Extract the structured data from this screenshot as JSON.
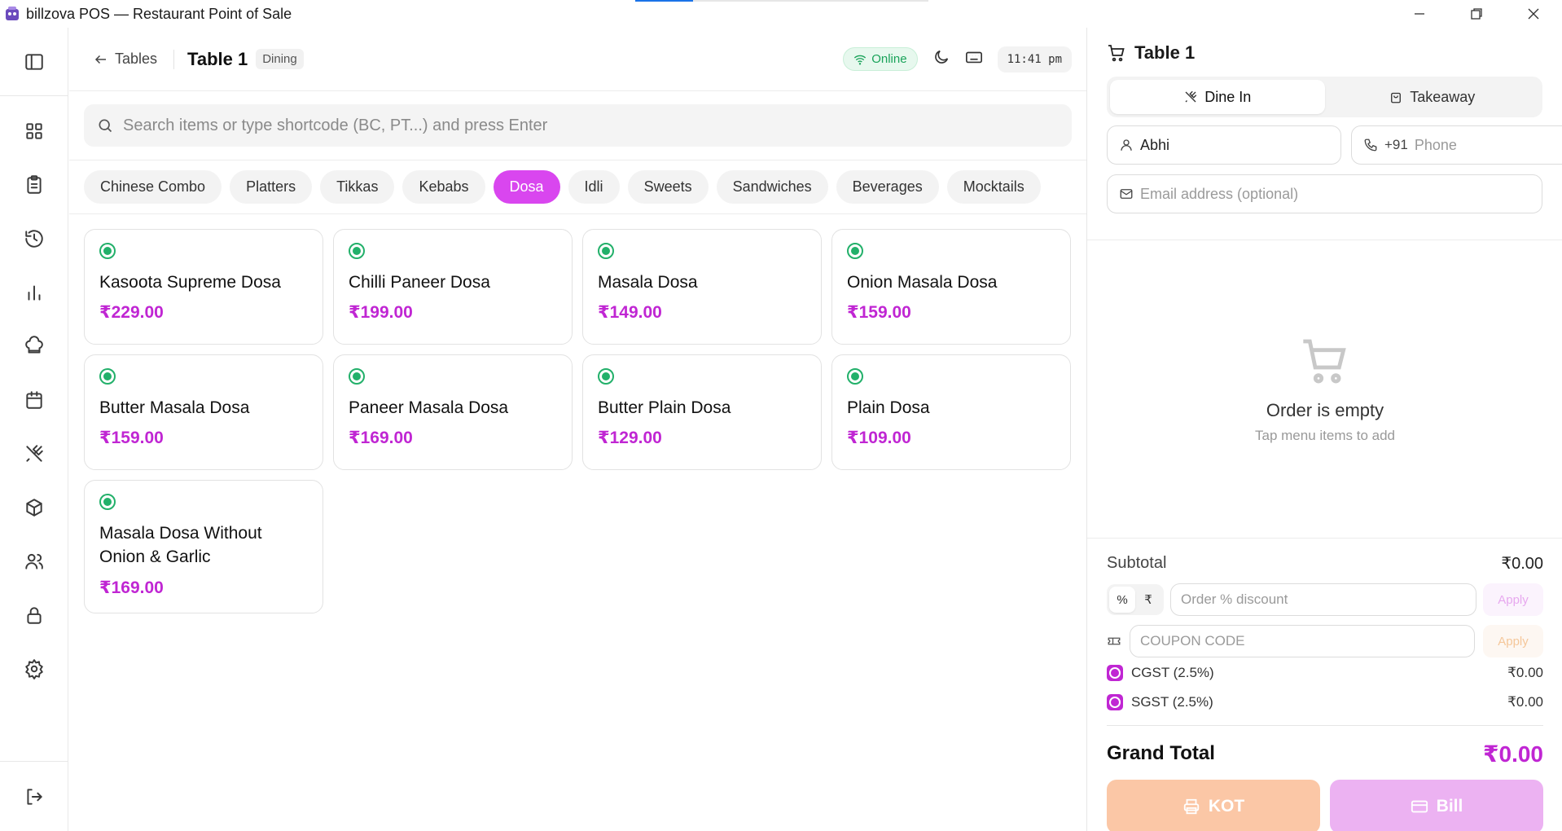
{
  "window": {
    "title": "billzova POS — Restaurant Point of Sale"
  },
  "topbar": {
    "back_label": "Tables",
    "table_name": "Table 1",
    "table_type": "Dining",
    "status": "Online",
    "time": "11:41 pm"
  },
  "search": {
    "placeholder": "Search items or type shortcode (BC, PT...) and press Enter"
  },
  "categories": [
    {
      "label": "Chinese Combo",
      "active": false
    },
    {
      "label": "Platters",
      "active": false
    },
    {
      "label": "Tikkas",
      "active": false
    },
    {
      "label": "Kebabs",
      "active": false
    },
    {
      "label": "Dosa",
      "active": true
    },
    {
      "label": "Idli",
      "active": false
    },
    {
      "label": "Sweets",
      "active": false
    },
    {
      "label": "Sandwiches",
      "active": false
    },
    {
      "label": "Beverages",
      "active": false
    },
    {
      "label": "Mocktails",
      "active": false
    }
  ],
  "items": [
    {
      "name": "Kasoota Supreme Dosa",
      "price": "₹229.00"
    },
    {
      "name": "Chilli Paneer Dosa",
      "price": "₹199.00"
    },
    {
      "name": "Masala Dosa",
      "price": "₹149.00"
    },
    {
      "name": "Onion Masala Dosa",
      "price": "₹159.00"
    },
    {
      "name": "Butter Masala Dosa",
      "price": "₹159.00"
    },
    {
      "name": "Paneer Masala Dosa",
      "price": "₹169.00"
    },
    {
      "name": "Butter Plain Dosa",
      "price": "₹129.00"
    },
    {
      "name": "Plain Dosa",
      "price": "₹109.00"
    },
    {
      "name": "Masala Dosa Without Onion & Garlic",
      "price": "₹169.00"
    }
  ],
  "order": {
    "title": "Table 1",
    "modes": {
      "dine_in": "Dine In",
      "takeaway": "Takeaway"
    },
    "customer_name": "Abhi",
    "phone_prefix": "+91",
    "phone_placeholder": "Phone",
    "email_placeholder": "Email address (optional)",
    "empty_title": "Order is empty",
    "empty_subtitle": "Tap menu items to add",
    "subtotal_label": "Subtotal",
    "subtotal_value": "₹0.00",
    "discount_percent_symbol": "%",
    "discount_rupee_symbol": "₹",
    "discount_placeholder": "Order % discount",
    "apply_label": "Apply",
    "coupon_placeholder": "COUPON CODE",
    "cgst_label": "CGST (2.5%)",
    "cgst_value": "₹0.00",
    "sgst_label": "SGST (2.5%)",
    "sgst_value": "₹0.00",
    "grand_total_label": "Grand Total",
    "grand_total_value": "₹0.00",
    "kot_label": "KOT",
    "bill_label": "Bill"
  },
  "colors": {
    "accent": "#d946ef",
    "price": "#c026d3",
    "online": "#1aa35a",
    "veg": "#22b06a",
    "kot": "#fbc7a6",
    "bill": "#ecb2f2"
  }
}
